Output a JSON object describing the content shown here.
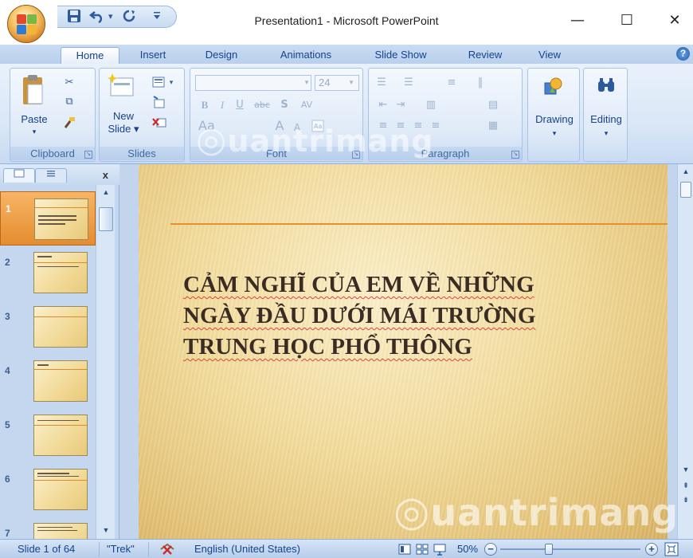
{
  "window": {
    "title": "Presentation1 - Microsoft PowerPoint",
    "minimize_glyph": "—",
    "maximize_glyph": "☐",
    "close_glyph": "✕"
  },
  "qat": {
    "dropdown_glyph": "▾"
  },
  "tabs": [
    {
      "label": "Home",
      "active": true
    },
    {
      "label": "Insert"
    },
    {
      "label": "Design"
    },
    {
      "label": "Animations"
    },
    {
      "label": "Slide Show"
    },
    {
      "label": "Review"
    },
    {
      "label": "View"
    }
  ],
  "help_glyph": "?",
  "ribbon": {
    "clipboard": {
      "label": "Clipboard",
      "paste_label": "Paste"
    },
    "slides": {
      "label": "Slides",
      "new_slide_label_1": "New",
      "new_slide_label_2": "Slide ▾"
    },
    "font": {
      "label": "Font",
      "font_size": "24"
    },
    "paragraph": {
      "label": "Paragraph"
    },
    "drawing": {
      "label": "Drawing"
    },
    "editing": {
      "label": "Editing"
    }
  },
  "left_pane": {
    "close_glyph": "x",
    "thumbnails": [
      {
        "num": "1",
        "selected": true
      },
      {
        "num": "2"
      },
      {
        "num": "3"
      },
      {
        "num": "4"
      },
      {
        "num": "5"
      },
      {
        "num": "6"
      },
      {
        "num": "7"
      }
    ]
  },
  "slide": {
    "title_lines": [
      "CẢM NGHĨ CỦA EM VỀ NHỮNG",
      "NGÀY ĐẦU DƯỚI MÁI TRƯỜNG",
      "TRUNG HỌC PHỔ THÔNG"
    ]
  },
  "watermark": {
    "text_top": "uantrimang",
    "text_bottom": "uantrimang"
  },
  "status": {
    "slide_info": "Slide 1 of 64",
    "theme": "\"Trek\"",
    "language": "English (United States)",
    "zoom": "50%"
  },
  "colors": {
    "accent_orange": "#e8902e",
    "ribbon_text": "#15428b",
    "slide_title": "#3a2c25"
  }
}
